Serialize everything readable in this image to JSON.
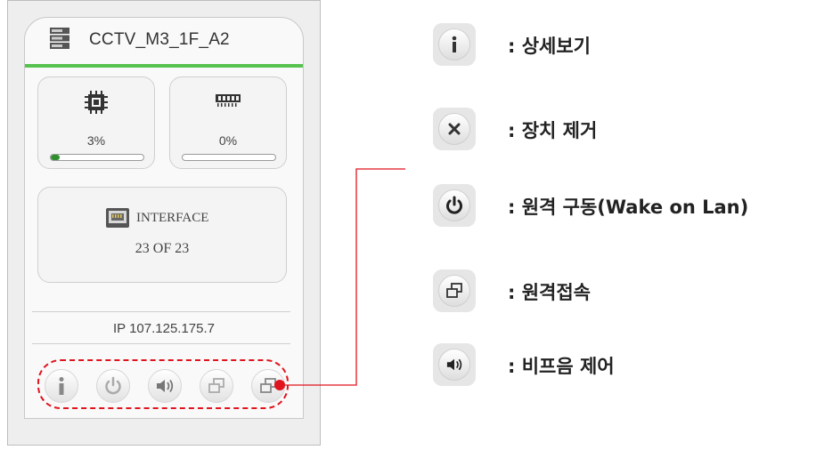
{
  "device": {
    "name": "CCTV_M3_1F_A2",
    "cpu_usage_label": "3%",
    "cpu_usage": 0.03,
    "memory_usage_label": "0%",
    "memory_usage": 0.0,
    "interface_label": "INTERFACE",
    "interface_count": "23 OF 23",
    "ip": "IP 107.125.175.7",
    "status_color": "#57c24f"
  },
  "action_buttons": [
    {
      "icon": "info-icon"
    },
    {
      "icon": "power-icon"
    },
    {
      "icon": "speaker-icon"
    },
    {
      "icon": "remote-connect-icon"
    },
    {
      "icon": "remote-connect-icon"
    }
  ],
  "legend": [
    {
      "icon": "info-icon",
      "text": ": 상세보기"
    },
    {
      "icon": "close-icon",
      "text": ": 장치 제거"
    },
    {
      "icon": "power-icon",
      "text": ": 원격 구동(Wake on Lan)"
    },
    {
      "icon": "remote-connect-icon",
      "text": ": 원격접속"
    },
    {
      "icon": "speaker-icon",
      "text": ": 비프음 제어"
    }
  ],
  "highlight_color": "#e0141e"
}
